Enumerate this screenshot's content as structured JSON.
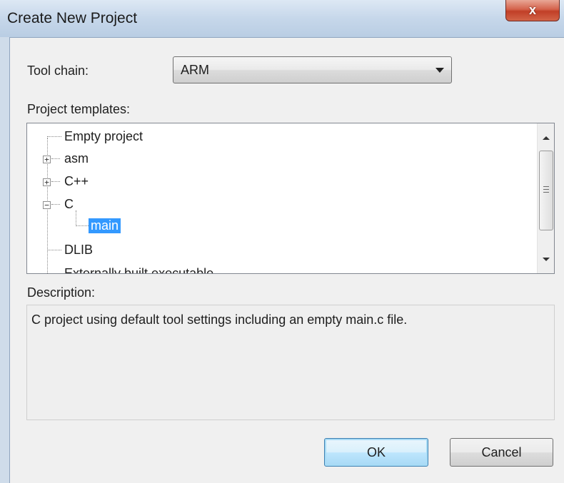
{
  "window": {
    "title": "Create New Project",
    "close_glyph": "x"
  },
  "toolchain": {
    "label": "Tool chain:",
    "selected": "ARM"
  },
  "templates": {
    "label": "Project templates:",
    "items": [
      {
        "label": "Empty project",
        "expander": ""
      },
      {
        "label": "asm",
        "expander": "+"
      },
      {
        "label": "C++",
        "expander": "+"
      },
      {
        "label": "C",
        "expander": "−"
      },
      {
        "label": "main",
        "expander": "",
        "selected": true
      },
      {
        "label": "DLIB",
        "expander": ""
      },
      {
        "label": "Externally built executable",
        "expander": ""
      }
    ]
  },
  "description": {
    "label": "Description:",
    "text": "C project using default tool settings including an empty main.c file."
  },
  "buttons": {
    "ok": "OK",
    "cancel": "Cancel"
  },
  "colors": {
    "selection": "#3399ff",
    "title_bar": "#c6d7ea",
    "close_button": "#c13f27"
  },
  "icons": [
    "close-icon",
    "chevron-down-icon",
    "expand-plus-icon",
    "collapse-minus-icon",
    "scroll-up-icon",
    "scroll-down-icon"
  ]
}
